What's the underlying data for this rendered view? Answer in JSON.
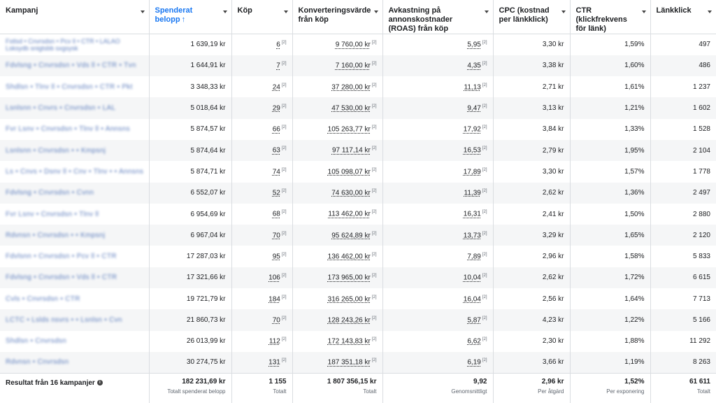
{
  "headers": [
    {
      "key": "kampanj",
      "label": "Kampanj"
    },
    {
      "key": "spend",
      "label": "Spenderat belopp",
      "arrow": "↑"
    },
    {
      "key": "kop",
      "label": "Köp"
    },
    {
      "key": "konv",
      "label": "Konverteringsvärde från köp"
    },
    {
      "key": "roas",
      "label": "Avkastning på annonskostnader (ROAS) från köp"
    },
    {
      "key": "cpc",
      "label": "CPC (kostnad per länkklick)"
    },
    {
      "key": "ctr",
      "label": "CTR (klickfrekvens för länk)"
    },
    {
      "key": "lank",
      "label": "Länkklick"
    }
  ],
  "ref_mark": "[2]",
  "rows": [
    {
      "name": "Fstlsd • Cnvrsdsn • Pcv ll • CTR • LALAO",
      "name2": "Lsksydb snigtsbb sxgsysk",
      "spend": "1 639,19 kr",
      "kop": "6",
      "konv": "9 760,00 kr",
      "roas": "5,95",
      "cpc": "3,30 kr",
      "ctr": "1,59%",
      "lank": "497"
    },
    {
      "name": "Fdvlsng • Cnvrsdsn • Vds ll • CTR • Tvn",
      "spend": "1 644,91 kr",
      "kop": "7",
      "konv": "7 160,00 kr",
      "roas": "4,35",
      "cpc": "3,38 kr",
      "ctr": "1,60%",
      "lank": "486"
    },
    {
      "name": "Shdlsn • Tlnv ll • Cnvrsdsn • CTR • Pkt",
      "spend": "3 348,33 kr",
      "kop": "24",
      "konv": "37 280,00 kr",
      "roas": "11,13",
      "cpc": "2,71 kr",
      "ctr": "1,61%",
      "lank": "1 237"
    },
    {
      "name": "Lsnlsnn • Cnvrs • Cnvrsdsn • LAL",
      "spend": "5 018,64 kr",
      "kop": "29",
      "konv": "47 530,00 kr",
      "roas": "9,47",
      "cpc": "3,13 kr",
      "ctr": "1,21%",
      "lank": "1 602"
    },
    {
      "name": "Fvr Lsnv • Cnvrsdsn • Tlnv ll • Annsns",
      "spend": "5 874,57 kr",
      "kop": "66",
      "konv": "105 263,77 kr",
      "roas": "17,92",
      "cpc": "3,84 kr",
      "ctr": "1,33%",
      "lank": "1 528"
    },
    {
      "name": "Lsnlsnn • Cnvrsdsn • • Kmpsnj",
      "spend": "5 874,64 kr",
      "kop": "63",
      "konv": "97 117,14 kr",
      "roas": "16,53",
      "cpc": "2,79 kr",
      "ctr": "1,95%",
      "lank": "2 104"
    },
    {
      "name": "Ls • Cnvs • Dsnv ll • Cnv • Tlnv • • Annsns",
      "spend": "5 874,71 kr",
      "kop": "74",
      "konv": "105 098,07 kr",
      "roas": "17,89",
      "cpc": "3,30 kr",
      "ctr": "1,57%",
      "lank": "1 778"
    },
    {
      "name": "Fdvlsng • Cnvrsdsn • Cvnn",
      "spend": "6 552,07 kr",
      "kop": "52",
      "konv": "74 630,00 kr",
      "roas": "11,39",
      "cpc": "2,62 kr",
      "ctr": "1,36%",
      "lank": "2 497"
    },
    {
      "name": "Fvr Lsnv • Cnvrsdsn • Tlnv ll",
      "spend": "6 954,69 kr",
      "kop": "68",
      "konv": "113 462,00 kr",
      "roas": "16,31",
      "cpc": "2,41 kr",
      "ctr": "1,50%",
      "lank": "2 880"
    },
    {
      "name": "Rdvnsn • Cnvrsdsn • • Kmpsnj",
      "spend": "6 967,04 kr",
      "kop": "70",
      "konv": "95 624,89 kr",
      "roas": "13,73",
      "cpc": "3,29 kr",
      "ctr": "1,65%",
      "lank": "2 120"
    },
    {
      "name": "Fdvlsnn • Cnvrsdsn • Pcv ll • CTR",
      "spend": "17 287,03 kr",
      "kop": "95",
      "konv": "136 462,00 kr",
      "roas": "7,89",
      "cpc": "2,96 kr",
      "ctr": "1,58%",
      "lank": "5 833"
    },
    {
      "name": "Fdvlsng • Cnvrsdsn • Vds ll • CTR",
      "spend": "17 321,66 kr",
      "kop": "106",
      "konv": "173 965,00 kr",
      "roas": "10,04",
      "cpc": "2,62 kr",
      "ctr": "1,72%",
      "lank": "6 615"
    },
    {
      "name": "Cvls • Cnvrsdsn • CTR",
      "spend": "19 721,79 kr",
      "kop": "184",
      "konv": "316 265,00 kr",
      "roas": "16,04",
      "cpc": "2,56 kr",
      "ctr": "1,64%",
      "lank": "7 713"
    },
    {
      "name": "LCTC • Lslds nsvrs • • Lsnlsn • Cvn",
      "spend": "21 860,73 kr",
      "kop": "70",
      "konv": "128 243,26 kr",
      "roas": "5,87",
      "cpc": "4,23 kr",
      "ctr": "1,22%",
      "lank": "5 166"
    },
    {
      "name": "Shdlsn • Cnvrsdsn",
      "spend": "26 013,99 kr",
      "kop": "112",
      "konv": "172 143,83 kr",
      "roas": "6,62",
      "cpc": "2,30 kr",
      "ctr": "1,88%",
      "lank": "11 292"
    },
    {
      "name": "Rdvnsn • Cnvrsdsn",
      "spend": "30 274,75 kr",
      "kop": "131",
      "konv": "187 351,18 kr",
      "roas": "6,19",
      "cpc": "3,66 kr",
      "ctr": "1,19%",
      "lank": "8 263"
    }
  ],
  "footer": {
    "label": "Resultat från 16 kampanjer",
    "spend": {
      "value": "182 231,69 kr",
      "sub": "Totalt spenderat belopp"
    },
    "kop": {
      "value": "1 155",
      "sub": "Totalt"
    },
    "konv": {
      "value": "1 807 356,15 kr",
      "sub": "Totalt"
    },
    "roas": {
      "value": "9,92",
      "sub": "Genomsnittligt"
    },
    "cpc": {
      "value": "2,96 kr",
      "sub": "Per åtgärd"
    },
    "ctr": {
      "value": "1,52%",
      "sub": "Per exponering"
    },
    "lank": {
      "value": "61 611",
      "sub": "Totalt"
    }
  },
  "colors": {
    "accent": "#1877f2",
    "border": "#dadde1",
    "stripe": "#f5f6f7"
  }
}
